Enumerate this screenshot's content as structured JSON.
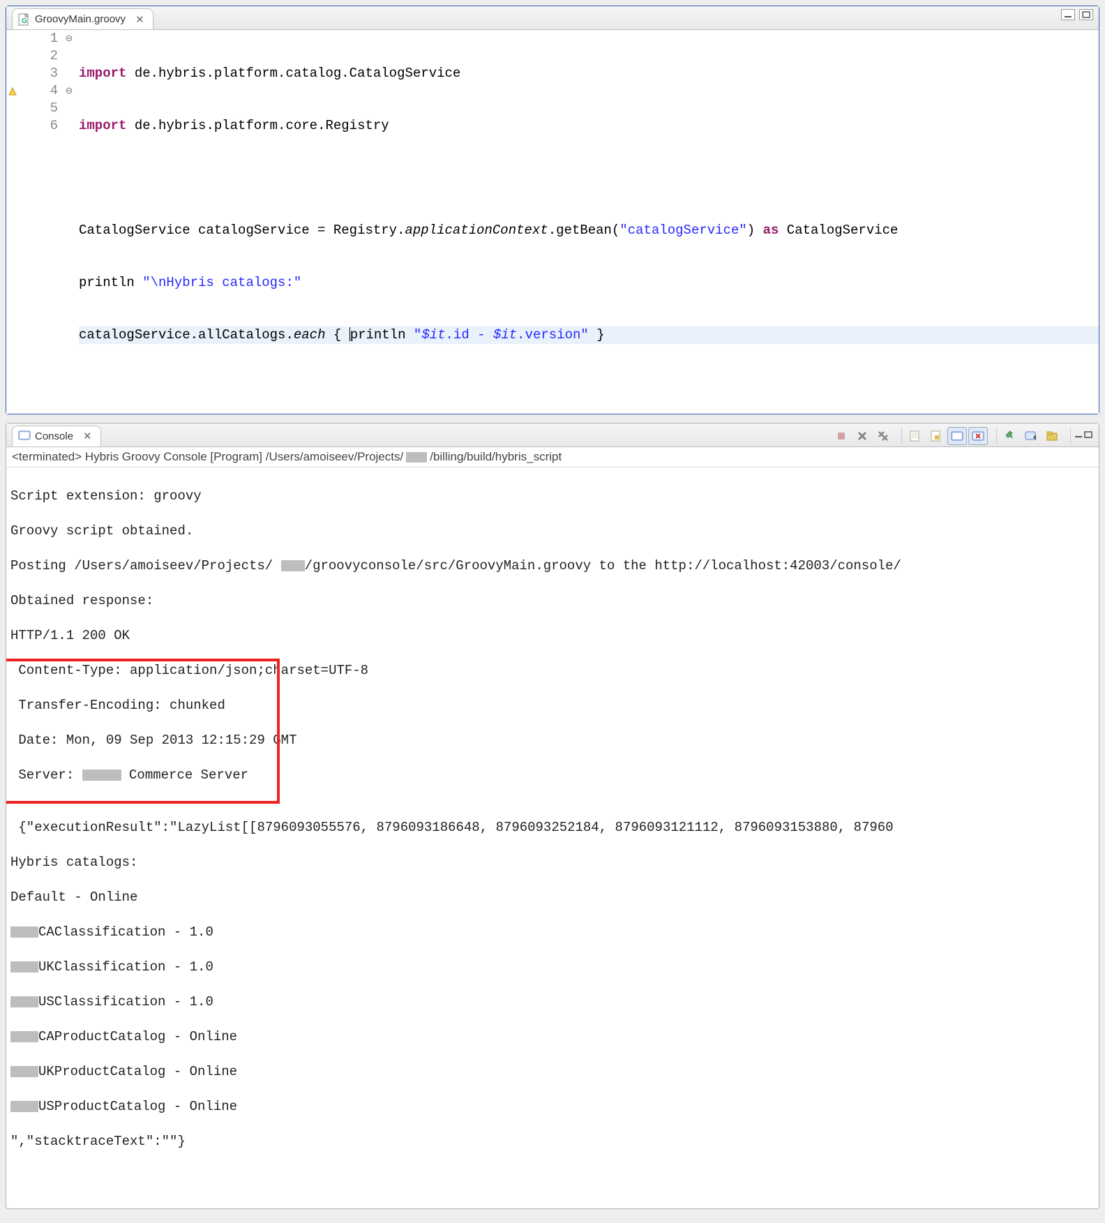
{
  "editor": {
    "tab_filename": "GroovyMain.groovy",
    "line_numbers": [
      "1",
      "2",
      "3",
      "4",
      "5",
      "6"
    ],
    "code": {
      "l1_kw": "import",
      "l1_rest": " de.hybris.platform.catalog.CatalogService",
      "l2_kw": "import",
      "l2_rest": " de.hybris.platform.core.Registry",
      "l3": "",
      "l4_a": "CatalogService catalogService = Registry.",
      "l4_it": "applicationContext",
      "l4_b": ".getBean(",
      "l4_str": "\"catalogService\"",
      "l4_c": ") ",
      "l4_kw": "as",
      "l4_d": " CatalogService",
      "l5_a": "println ",
      "l5_str": "\"\\nHybris catalogs:\"",
      "l6_a": "catalogService.allCatalogs.",
      "l6_it": "each",
      "l6_b": " { ",
      "l6_c": "println ",
      "l6_str1": "\"",
      "l6_str2": "$it",
      "l6_str3": ".id - ",
      "l6_str4": "$it",
      "l6_str5": ".version\"",
      "l6_d": " }"
    }
  },
  "console": {
    "tab_label": "Console",
    "header_a": "<terminated> Hybris Groovy Console [Program] /Users/amoiseev/Projects/",
    "header_b": "/billing/build/hybris_script",
    "out": {
      "l1": "Script extension: groovy",
      "l2": "Groovy script obtained.",
      "l3a": "Posting /Users/amoiseev/Projects/",
      "l3b": "/groovyconsole/src/GroovyMain.groovy to the http://localhost:42003/console/",
      "l4": "Obtained response:",
      "l5": "HTTP/1.1 200 OK",
      "l6": " Content-Type: application/json;charset=UTF-8",
      "l7": " Transfer-Encoding: chunked",
      "l8": " Date: Mon, 09 Sep 2013 12:15:29 GMT",
      "l9a": " Server: ",
      "l9b": " Commerce Server",
      "l10": "",
      "l11": " {\"executionResult\":\"LazyList[[8796093055576, 8796093186648, 8796093252184, 8796093121112, 8796093153880, 87960",
      "l12": "Hybris catalogs:",
      "l13": "Default - Online",
      "l14b": "CAClassification - 1.0",
      "l15b": "UKClassification - 1.0",
      "l16b": "USClassification - 1.0",
      "l17b": "CAProductCatalog - Online",
      "l18b": "UKProductCatalog - Online",
      "l19b": "USProductCatalog - Online",
      "l20": "\",\"stacktraceText\":\"\"}"
    }
  }
}
